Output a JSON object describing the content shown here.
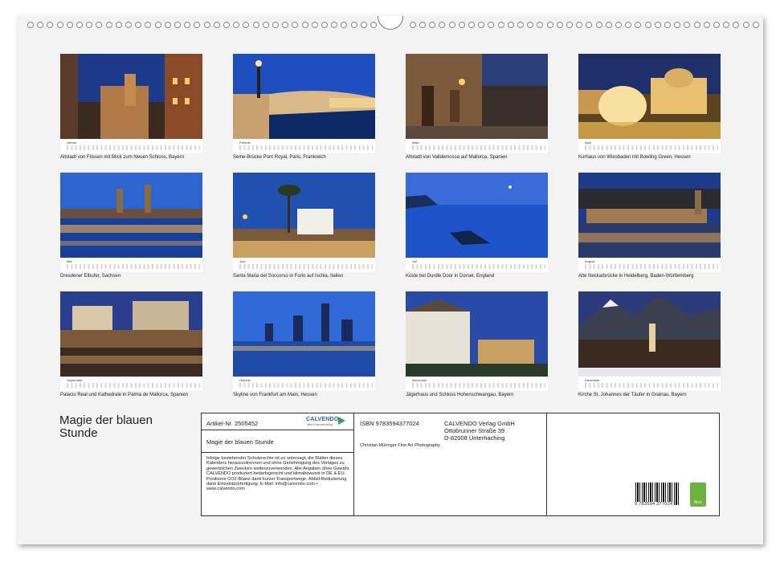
{
  "title": "Magie der blauen Stunde",
  "months": [
    {
      "month": "Januar",
      "year": "2027",
      "caption": "Altstadt von Füssen mit Blick zum Neuen Schloss, Bayern"
    },
    {
      "month": "Februar",
      "year": "2027",
      "caption": "Seine-Brücke Pont Royal, Paris, Frankreich"
    },
    {
      "month": "März",
      "year": "2027",
      "caption": "Altstadt von Valldemossa auf Mallorca, Spanien"
    },
    {
      "month": "April",
      "year": "2027",
      "caption": "Kurhaus von Wiesbaden mit Bowling Green, Hessen"
    },
    {
      "month": "Mai",
      "year": "2027",
      "caption": "Dresdener Elbufer, Sachsen"
    },
    {
      "month": "Juni",
      "year": "2027",
      "caption": "Santa Maria del Soccorso in Forio auf Ischia, Italien"
    },
    {
      "month": "Juli",
      "year": "2027",
      "caption": "Küste bei Durdle Door in Dorset, England"
    },
    {
      "month": "August",
      "year": "2027",
      "caption": "Alte Neckarbrücke in Heidelberg, Baden-Württemberg"
    },
    {
      "month": "September",
      "year": "2027",
      "caption": "Palacio Real und Kathedrale in Palma de Mallorca, Spanien"
    },
    {
      "month": "Oktober",
      "year": "2027",
      "caption": "Skyline von Frankfurt am Main, Hessen"
    },
    {
      "month": "November",
      "year": "2027",
      "caption": "Jägerhaus und Schloss Hohenschwangau, Bayern"
    },
    {
      "month": "Dezember",
      "year": "2027",
      "caption": "Kirche St. Johannes der Täufer in Grainau, Bayern"
    }
  ],
  "info": {
    "article": "Artikel-Nr. 2505452",
    "logo": "CALVENDO",
    "logo_sub": "Mein Kalenderverlag",
    "product_title": "Magie der blauen Stunde",
    "legal": "Infolge bestehender Schutzrechte ist es untersagt, die Blätter dieses Kalenders herauszutrennen und ohne Genehmigung des Verlages zu gewerblichen Zwecken weiterzuverwenden. Alle Angaben ohne Gewähr. CALVENDO produziert bedarfsgerecht und klimabewusst in DE & EU. Positivere CO2-Bilanz dank kurzer Transportwege. Abfall-Reduzierung dank Einzelstückfertigung. E-Mail: info@calvendo.com • www.calvendo.com",
    "isbn": "ISBN 9783594377024",
    "publisher_name": "CALVENDO Verlag GmbH",
    "publisher_street": "Ottobrunner Straße 39",
    "publisher_city": "D-82008 Unterhaching",
    "author": "Christian Müringer Fine Art Photography",
    "barcode_number": "9 783594 377024",
    "feco": "feco"
  }
}
